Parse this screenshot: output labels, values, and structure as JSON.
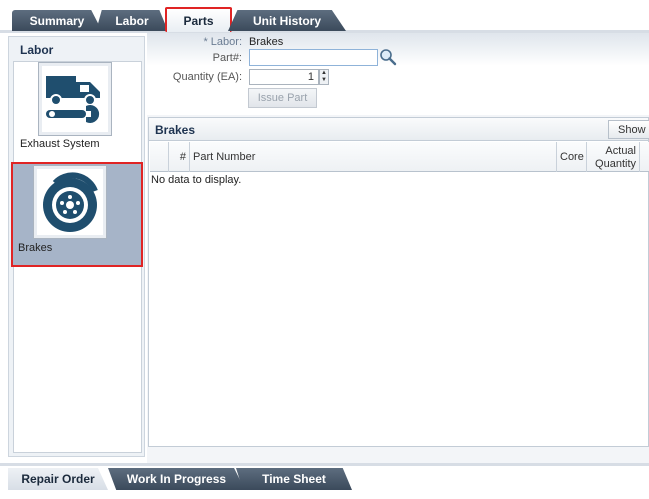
{
  "top_tabs": [
    {
      "label": "Summary"
    },
    {
      "label": "Labor"
    },
    {
      "label": "Parts"
    },
    {
      "label": "Unit History"
    }
  ],
  "left_panel": {
    "title": "Labor",
    "items": [
      {
        "label": "Exhaust System",
        "icon": "truck-wrench-icon"
      },
      {
        "label": "Brakes",
        "icon": "brake-disc-icon"
      }
    ]
  },
  "form": {
    "labor_label": "* Labor:",
    "labor_value": "Brakes",
    "part_label": "Part#:",
    "part_value": "",
    "quantity_label": "Quantity (EA):",
    "quantity_value": "1",
    "issue_button": "Issue Part"
  },
  "parts_panel": {
    "title": "Brakes",
    "show_button": "Show",
    "columns": [
      "#",
      "Part Number",
      "Core",
      "Actual",
      "Quantity"
    ],
    "empty_text": "No data to display."
  },
  "bottom_tabs": [
    {
      "label": "Repair Order"
    },
    {
      "label": "Work In Progress"
    },
    {
      "label": "Time Sheet"
    }
  ],
  "colors": {
    "accent": "#3b4a5b",
    "highlight": "#e02424",
    "selected_bg": "#a6b4c8"
  }
}
